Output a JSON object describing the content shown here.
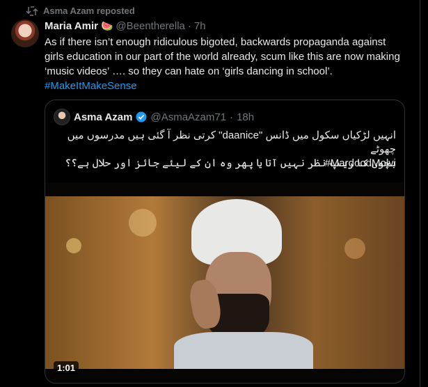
{
  "repost": {
    "label": "Asma Azam reposted",
    "icon": "repost-icon"
  },
  "tweet": {
    "author_name": "Maria Amir",
    "author_emoji": "🍉",
    "handle": "@Beentherella",
    "dot": "·",
    "time": "7h",
    "text": "As if there isn’t enough ridiculous bigoted, backwards propaganda against girls education in our part of the world already, scum like this are now making ‘music videos’ …. so they can hate on ‘girls dancing in school’.",
    "hashtag": "#MakeItMakeSense"
  },
  "quote": {
    "author_name": "Asma Azam",
    "verified_icon": "verified-badge-icon",
    "handle": "@AsmaAzam71",
    "dot": "·",
    "time": "18h",
    "line1": "انہیں لڑکیاں سکول میں ڈانس \"daanice\" کرتی نظر آ گئی ہیں مدرسوں میں چھوٹے",
    "line2": "بچوں کا ریپ نظر نہیں آتا یا پھر وہ ان کے لیئے جائز اور حلال ہے؟؟",
    "hashtag": "#MardoodMolvi",
    "video_duration": "1:01"
  },
  "colors": {
    "link": "#1d9bf0",
    "muted": "#71767b",
    "text": "#e7e9ea",
    "border": "#2f3336"
  }
}
